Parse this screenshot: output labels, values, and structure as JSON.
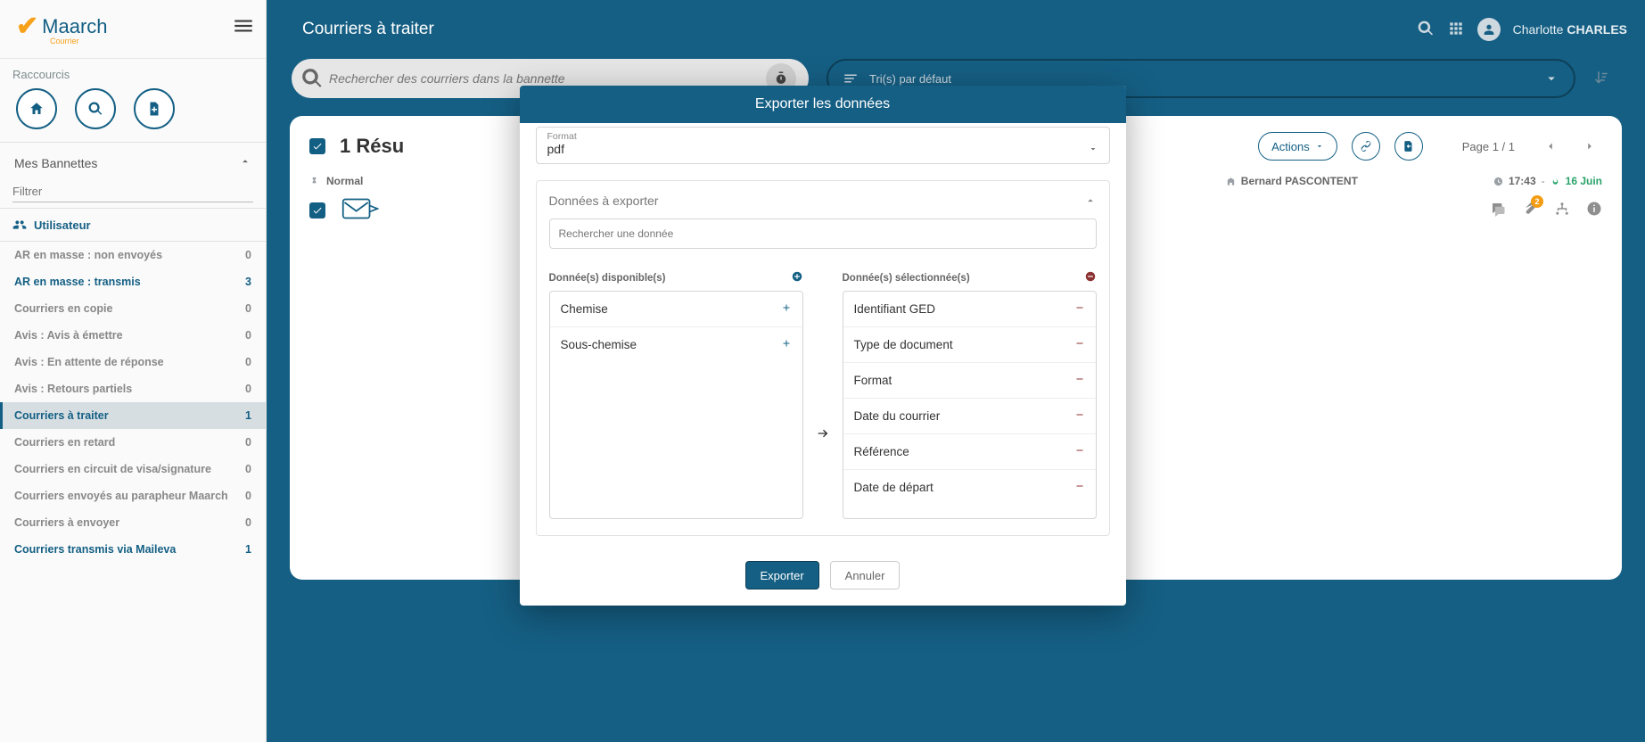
{
  "logo": {
    "brand": "Maarch",
    "sub": "Courrier"
  },
  "header": {
    "title": "Courriers à traiter",
    "user_first": "Charlotte",
    "user_last": "CHARLES"
  },
  "search": {
    "placeholder": "Rechercher des courriers dans la bannette",
    "sort_label": "Tri(s) par défaut"
  },
  "shortcuts_label": "Raccourcis",
  "bannettes_label": "Mes Bannettes",
  "filter_placeholder": "Filtrer",
  "user_section": "Utilisateur",
  "nav": [
    {
      "label": "AR en masse : non envoyés",
      "count": "0",
      "cls": ""
    },
    {
      "label": "AR en masse : transmis",
      "count": "3",
      "cls": "highlight"
    },
    {
      "label": "Courriers en copie",
      "count": "0",
      "cls": ""
    },
    {
      "label": "Avis : Avis à émettre",
      "count": "0",
      "cls": ""
    },
    {
      "label": "Avis : En attente de réponse",
      "count": "0",
      "cls": ""
    },
    {
      "label": "Avis : Retours partiels",
      "count": "0",
      "cls": ""
    },
    {
      "label": "Courriers à traiter",
      "count": "1",
      "cls": "active highlight"
    },
    {
      "label": "Courriers en retard",
      "count": "0",
      "cls": ""
    },
    {
      "label": "Courriers en circuit de visa/signature",
      "count": "0",
      "cls": ""
    },
    {
      "label": "Courriers envoyés au parapheur Maarch",
      "count": "0",
      "cls": ""
    },
    {
      "label": "Courriers à envoyer",
      "count": "0",
      "cls": ""
    },
    {
      "label": "Courriers transmis via Maileva",
      "count": "1",
      "cls": "highlight"
    }
  ],
  "panel": {
    "result_prefix": "1 Résu",
    "actions_label": "Actions",
    "page_label": "Page 1 / 1"
  },
  "row": {
    "priority": "Normal",
    "assignee": "Bernard PASCONTENT",
    "time": "17:43",
    "due": "16 Juin",
    "attach_badge": "2"
  },
  "modal": {
    "title": "Exporter les données",
    "format_label": "Format",
    "format_value": "pdf",
    "section_title": "Données à exporter",
    "search_placeholder": "Rechercher une donnée",
    "available_label": "Donnée(s) disponible(s)",
    "selected_label": "Donnée(s) sélectionnée(s)",
    "available": [
      "Chemise",
      "Sous-chemise"
    ],
    "selected": [
      "Identifiant GED",
      "Type de document",
      "Format",
      "Date du courrier",
      "Référence",
      "Date de départ"
    ],
    "export_btn": "Exporter",
    "cancel_btn": "Annuler"
  }
}
